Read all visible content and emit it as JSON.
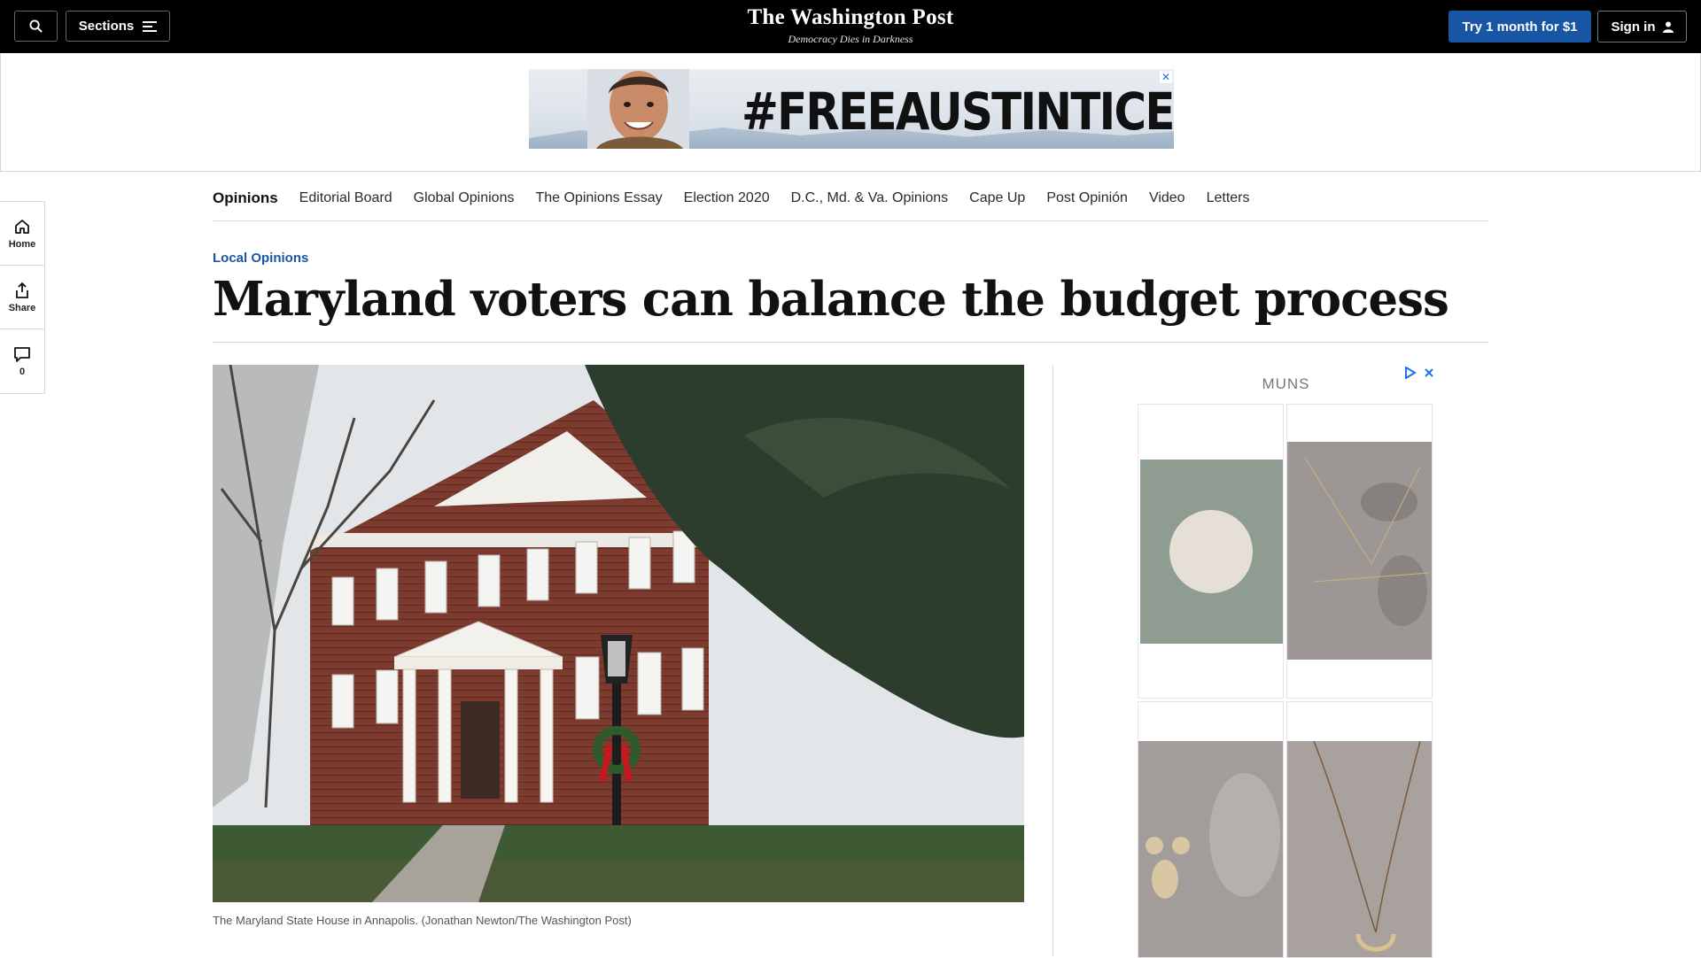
{
  "header": {
    "sections_label": "Sections",
    "brand_name": "The Washington Post",
    "brand_tagline": "Democracy Dies in Darkness",
    "try_label": "Try 1 month for $1",
    "signin_label": "Sign in",
    "icons": [
      "search-icon",
      "menu-icon",
      "user-icon"
    ]
  },
  "banner_ad": {
    "text": "#FREEAUSTINTICE",
    "close_label": "✕"
  },
  "section_nav": {
    "items": [
      "Opinions",
      "Editorial Board",
      "Global Opinions",
      "The Opinions Essay",
      "Election 2020",
      "D.C., Md. & Va. Opinions",
      "Cape Up",
      "Post Opinión",
      "Video",
      "Letters"
    ]
  },
  "rail": {
    "home_label": "Home",
    "share_label": "Share",
    "comments_count": "0",
    "icons": [
      "home-icon",
      "share-icon",
      "comment-icon"
    ]
  },
  "article": {
    "kicker": "Local Opinions",
    "headline": "Maryland voters can balance the budget process",
    "photo_caption": "The Maryland State House in Annapolis. (Jonathan Newton/The Washington Post)"
  },
  "side_ad": {
    "brand": "MUNS",
    "adchoices_icons": [
      "adchoices-icon",
      "close-icon"
    ]
  },
  "colors": {
    "topbar": "#000000",
    "accent": "#1955a5",
    "kicker": "#1955a5"
  }
}
